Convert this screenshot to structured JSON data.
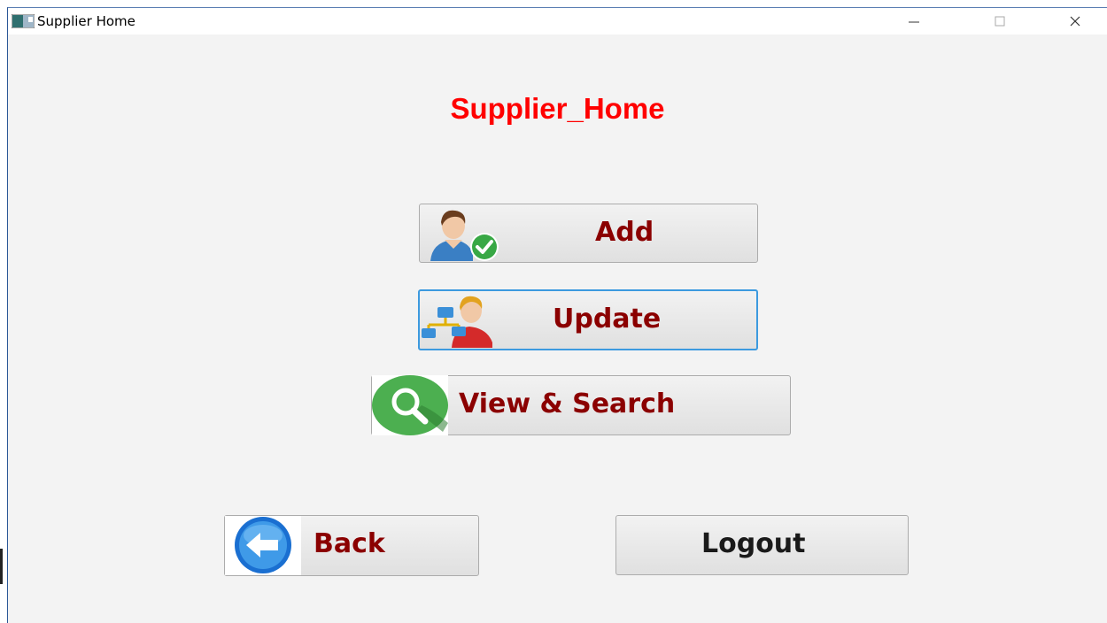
{
  "window": {
    "title": "Supplier Home",
    "controls": {
      "minimize": "minimize",
      "maximize": "maximize",
      "close": "close"
    }
  },
  "heading": "Supplier_Home",
  "menu": {
    "add_label": "Add",
    "update_label": "Update",
    "view_search_label": "View & Search"
  },
  "footer": {
    "back_label": "Back",
    "logout_label": "Logout"
  },
  "icons": {
    "add": "user-check-icon",
    "update": "user-network-icon",
    "view_search": "magnifier-icon",
    "back": "back-arrow-icon"
  },
  "colors": {
    "heading": "#ff0000",
    "button_text": "#8b0000",
    "focus_border": "#3c9adf"
  }
}
